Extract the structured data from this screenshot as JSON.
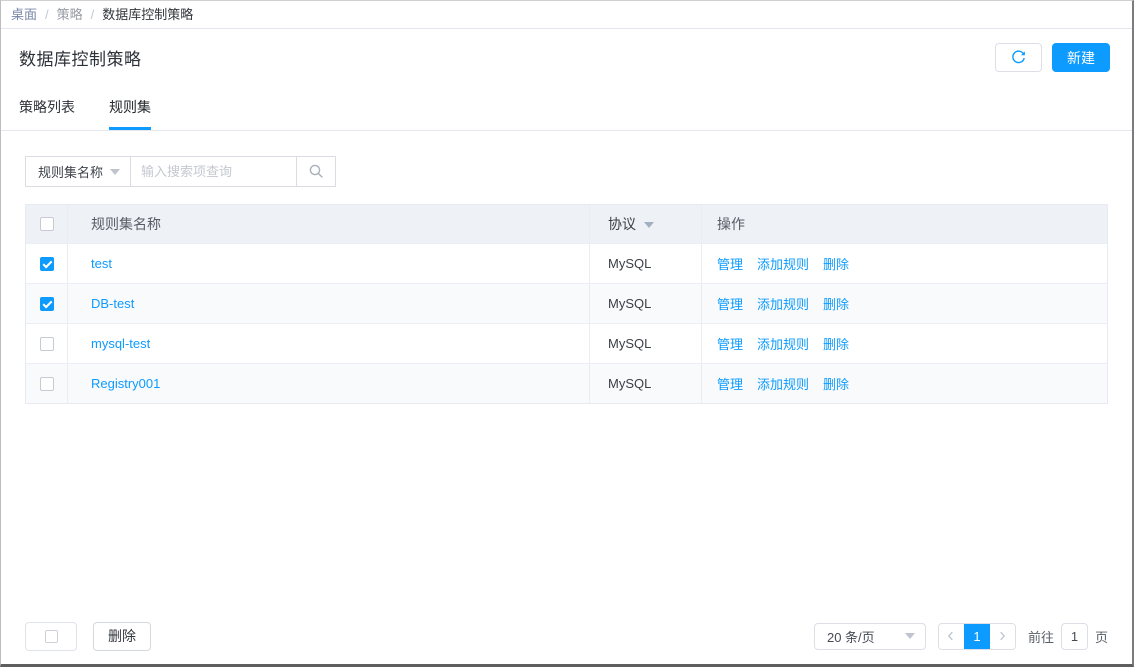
{
  "colors": {
    "accent": "#0d9bff",
    "link": "#0d9bff",
    "header_bg": "#eef1f6",
    "stripe_bg": "#f8fafc",
    "border": "#e4e7ed"
  },
  "icons": {
    "refresh": "circular-arrow",
    "search": "magnifier",
    "dropdown": "filled-down-triangle",
    "sort": "filled-down-triangle",
    "prev": "chevron-left",
    "next": "chevron-right",
    "check": "checkmark"
  },
  "breadcrumb": {
    "separator": "/",
    "items": [
      "桌面",
      "策略",
      "数据库控制策略"
    ]
  },
  "page": {
    "title": "数据库控制策略",
    "new_button": "新建"
  },
  "tabs": [
    {
      "label": "策略列表",
      "active": false
    },
    {
      "label": "规则集",
      "active": true
    }
  ],
  "search": {
    "field_selector": "规则集名称",
    "placeholder": "输入搜索项查询"
  },
  "table": {
    "columns": [
      "规则集名称",
      "协议",
      "操作"
    ],
    "actions": [
      "管理",
      "添加规则",
      "删除"
    ],
    "rows": [
      {
        "name": "test",
        "protocol": "MySQL",
        "checked": true
      },
      {
        "name": "DB-test",
        "protocol": "MySQL",
        "checked": true
      },
      {
        "name": "mysql-test",
        "protocol": "MySQL",
        "checked": false
      },
      {
        "name": "Registry001",
        "protocol": "MySQL",
        "checked": false
      }
    ]
  },
  "footer": {
    "delete_button": "删除",
    "page_size": "20 条/页",
    "current_page": "1",
    "goto_label": "前往",
    "goto_value": "1",
    "page_unit": "页"
  }
}
